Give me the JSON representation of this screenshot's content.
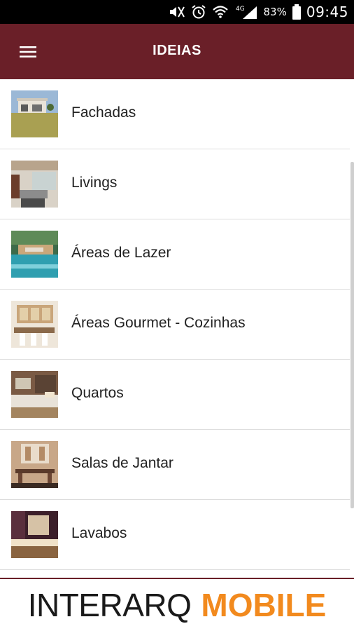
{
  "status_bar": {
    "battery_percent": "83%",
    "time": "09:45",
    "network": "4G",
    "icons": [
      "mute-icon",
      "alarm-icon",
      "wifi-icon",
      "signal-icon",
      "battery-icon"
    ]
  },
  "app_bar": {
    "title": "IDEIAS",
    "menu_icon": "hamburger-menu-icon",
    "color": "#6a1f28"
  },
  "list": {
    "items": [
      {
        "label": "Fachadas",
        "thumb": "facade-photo"
      },
      {
        "label": "Livings",
        "thumb": "living-room-photo"
      },
      {
        "label": "Áreas de Lazer",
        "thumb": "pool-area-photo"
      },
      {
        "label": "Áreas Gourmet - Cozinhas",
        "thumb": "gourmet-kitchen-photo"
      },
      {
        "label": "Quartos",
        "thumb": "bedroom-photo"
      },
      {
        "label": "Salas de Jantar",
        "thumb": "dining-room-photo"
      },
      {
        "label": "Lavabos",
        "thumb": "washroom-photo"
      }
    ]
  },
  "banner": {
    "brand_part1": "INTERARQ",
    "brand_part2": "MOBILE",
    "accent_color": "#f28a1e"
  }
}
